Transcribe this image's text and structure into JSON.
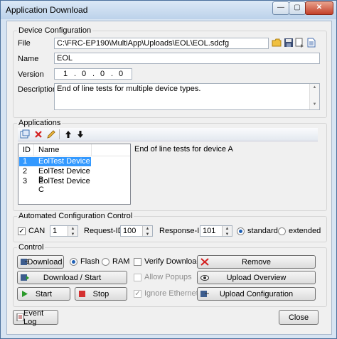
{
  "window": {
    "title": "Application Download",
    "minimize": "—",
    "maximize": "▢",
    "close": "✕"
  },
  "device_config": {
    "legend": "Device Configuration",
    "file_label": "File",
    "file_value": "C:\\FRC-EP190\\MultiApp\\Uploads\\EOL\\EOL.sdcfg",
    "name_label": "Name",
    "name_value": "EOL",
    "version_label": "Version",
    "version_parts": [
      "1",
      "0",
      "0",
      "0"
    ],
    "version_sep": ".",
    "description_label": "Description",
    "description_value": "End of line tests for multiple device types."
  },
  "applications": {
    "legend": "Applications",
    "columns": [
      "ID",
      "Name"
    ],
    "rows": [
      {
        "id": "1",
        "name": "EolTest Device A"
      },
      {
        "id": "2",
        "name": "EolTest Device B"
      },
      {
        "id": "3",
        "name": "EolTest Device C"
      }
    ],
    "detail": "End of line tests for device A"
  },
  "auto_config": {
    "legend": "Automated Configuration Control",
    "can_label": "CAN",
    "can_value": "1",
    "request_label": "Request-ID",
    "request_value": "100",
    "response_label": "Response-ID",
    "response_value": "101",
    "standard_label": "standard",
    "extended_label": "extended"
  },
  "control": {
    "legend": "Control",
    "download": "Download",
    "flash": "Flash",
    "ram": "RAM",
    "verify": "Verify Download",
    "remove": "Remove",
    "download_start": "Download / Start",
    "allow_popups": "Allow Popups",
    "upload_overview": "Upload Overview",
    "start": "Start",
    "stop": "Stop",
    "ignore_ethernet": "Ignore Ethernet",
    "upload_configuration": "Upload Configuration"
  },
  "footer": {
    "event_log": "Event Log",
    "close": "Close"
  },
  "colors": {
    "accent": "#3399ff",
    "title_bg": "#bcd2ea",
    "selection": "#3399ff"
  }
}
